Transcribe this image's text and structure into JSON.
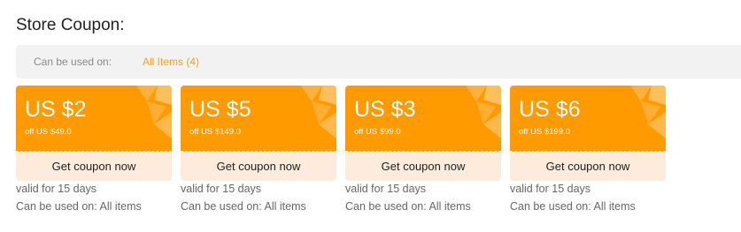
{
  "page_title": "Store Coupon:",
  "filter": {
    "label": "Can be used on:",
    "value": "All Items (4)"
  },
  "colors": {
    "accent": "#ff9a00",
    "link": "#f5a31a",
    "button_bg": "#fdebdc"
  },
  "coupons": [
    {
      "amount": "US $2",
      "condition": "off US $49.0",
      "button": "Get coupon now",
      "validity": "valid for 15 days",
      "scope": "Can be used on: All items"
    },
    {
      "amount": "US $5",
      "condition": "off US $149.0",
      "button": "Get coupon now",
      "validity": "valid for 15 days",
      "scope": "Can be used on: All items"
    },
    {
      "amount": "US $3",
      "condition": "off US $99.0",
      "button": "Get coupon now",
      "validity": "valid for 15 days",
      "scope": "Can be used on: All items"
    },
    {
      "amount": "US $6",
      "condition": "off US $199.0",
      "button": "Get coupon now",
      "validity": "valid for 15 days",
      "scope": "Can be used on: All items"
    }
  ]
}
